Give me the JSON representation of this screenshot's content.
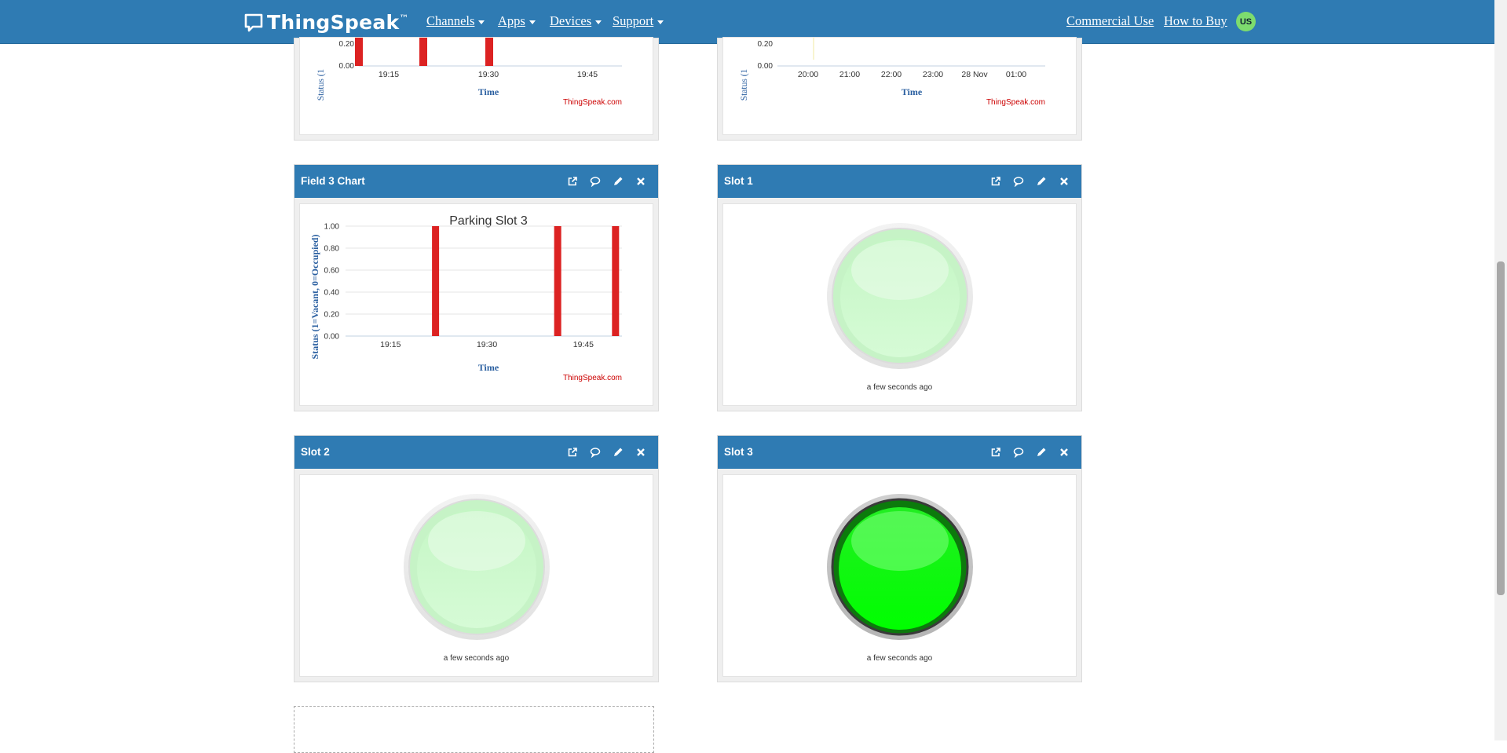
{
  "nav": {
    "brand": "ThingSpeak",
    "brand_tm": "™",
    "items": [
      {
        "label": "Channels"
      },
      {
        "label": "Apps"
      },
      {
        "label": "Devices"
      },
      {
        "label": "Support"
      }
    ],
    "right_links": [
      {
        "label": "Commercial Use"
      },
      {
        "label": "How to Buy"
      }
    ],
    "avatar": "US"
  },
  "widgets": {
    "top_left": {
      "ylabel_fragment": "Status (1",
      "xlabel": "Time",
      "credit": "ThingSpeak.com",
      "ticks_y": [
        "0.20",
        "0.00"
      ],
      "ticks_x": [
        "19:15",
        "19:30",
        "19:45"
      ]
    },
    "top_right": {
      "ylabel_fragment": "Status (1",
      "xlabel": "Time",
      "credit": "ThingSpeak.com",
      "ticks_y": [
        "0.20",
        "0.00"
      ],
      "ticks_x": [
        "20:00",
        "21:00",
        "22:00",
        "23:00",
        "28 Nov",
        "01:00"
      ]
    },
    "field3": {
      "header": "Field 3 Chart",
      "title": "Parking Slot 3",
      "ylabel": "Status (1=Vacant, 0=Occupied)",
      "xlabel": "Time",
      "credit": "ThingSpeak.com"
    },
    "slot1": {
      "header": "Slot 1",
      "time": "a few seconds ago",
      "on": false
    },
    "slot2": {
      "header": "Slot 2",
      "time": "a few seconds ago",
      "on": false
    },
    "slot3": {
      "header": "Slot 3",
      "time": "a few seconds ago",
      "on": true
    }
  },
  "chart_data": [
    {
      "type": "bar",
      "title": "",
      "xlabel": "Time",
      "ylabel": "Status (1",
      "x": [
        "19:13",
        "19:22",
        "19:30"
      ],
      "values": [
        1,
        1,
        1
      ],
      "x_ticks": [
        "19:15",
        "19:30",
        "19:45"
      ],
      "ylim": [
        0,
        1
      ],
      "grid": true
    },
    {
      "type": "line",
      "title": "",
      "xlabel": "Time",
      "ylabel": "Status (1",
      "x_ticks": [
        "20:00",
        "21:00",
        "22:00",
        "23:00",
        "28 Nov",
        "01:00"
      ],
      "ylim": [
        0,
        1
      ],
      "grid": true
    },
    {
      "type": "bar",
      "title": "Parking Slot 3",
      "xlabel": "Time",
      "ylabel": "Status (1=Vacant, 0=Occupied)",
      "x": [
        "19:15",
        "19:30",
        "19:45"
      ],
      "x_ticks": [
        "19:15",
        "19:30",
        "19:45"
      ],
      "y_ticks": [
        "0.00",
        "0.20",
        "0.40",
        "0.60",
        "0.80",
        "1.00"
      ],
      "bars": [
        {
          "x": "19:22",
          "value": 1
        },
        {
          "x": "19:41",
          "value": 1
        },
        {
          "x": "19:50",
          "value": 1
        }
      ],
      "ylim": [
        0,
        1
      ],
      "grid": true,
      "bar_color": "#dc2222"
    }
  ],
  "colors": {
    "nav": "#2f7bb3",
    "bar": "#dc2222",
    "lamp_on": "#00ee00",
    "lamp_off": "#c9f7c9",
    "axis_label": "#2a5fa0",
    "credit": "#cc0000"
  }
}
